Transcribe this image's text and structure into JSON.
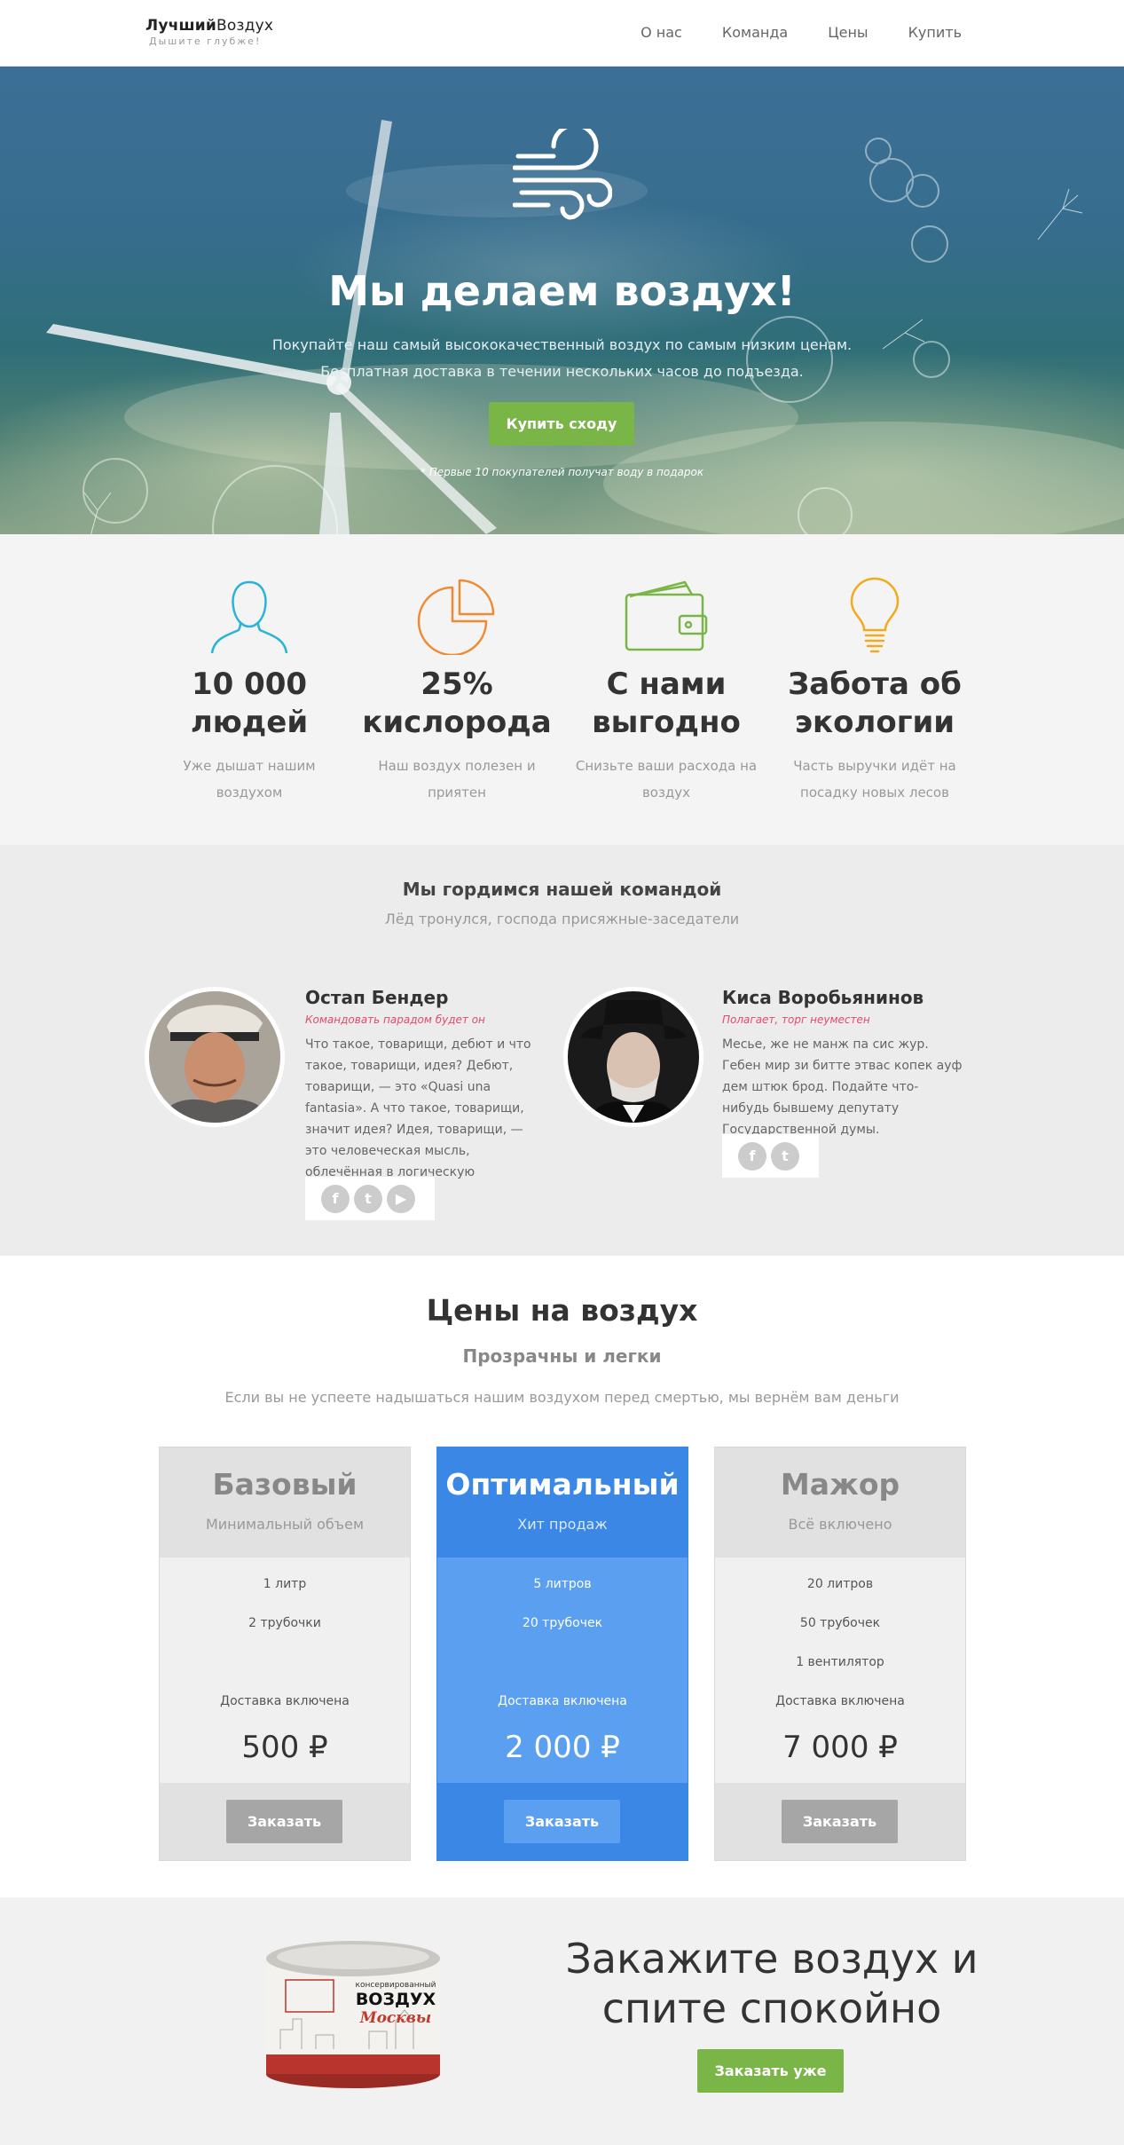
{
  "header": {
    "logo_bold": "Лучший",
    "logo_light": "Воздух",
    "tagline": "Дышите глубже!",
    "nav": [
      "О нас",
      "Команда",
      "Цены",
      "Купить"
    ]
  },
  "hero": {
    "title": "Мы делаем воздух!",
    "line1": "Покупайте наш самый высококачественный воздух по самым низким ценам.",
    "line2": "Бесплатная доставка в течении нескольких часов до подъезда.",
    "button": "Купить сходу",
    "note": "* Первые 10 покупателей получат воду в подарок"
  },
  "features": [
    {
      "icon": "person-outline-icon",
      "title": "10 000 людей",
      "text": "Уже дышат нашим воздухом",
      "color": "#2bb3d6"
    },
    {
      "icon": "pie-chart-icon",
      "title": "25% кислорода",
      "text": "Наш воздух полезен и приятен",
      "color": "#f08a32"
    },
    {
      "icon": "wallet-icon",
      "title": "С нами выгодно",
      "text": "Снизьте ваши расхода на воздух",
      "color": "#7ab547"
    },
    {
      "icon": "lightbulb-icon",
      "title": "Забота об экологии",
      "text": "Часть выручки идёт на посадку новых лесов",
      "color": "#f2a91e"
    }
  ],
  "team": {
    "title": "Мы гордимся нашей командой",
    "subtitle": "Лёд тронулся, господа присяжные-заседатели",
    "members": [
      {
        "name": "Остап Бендер",
        "role": "Командовать парадом будет он",
        "bio": "Что такое, товарищи, дебют и что такое, товарищи, идея? Дебют, товарищи, — это «Quasi una fantasia». А что такое, товарищи, значит идея? Идея, товарищи, — это человеческая мысль, облечённая в логическую шахматную форму.",
        "socials": [
          "facebook-icon",
          "twitter-icon",
          "youtube-icon"
        ]
      },
      {
        "name": "Киса Воробьянинов",
        "role": "Полагает, торг неуместен",
        "bio": "Месье, же не манж па сис жур. Гебен мир зи битте этвас копек ауф дем штюк брод. Подайте что-нибудь бывшему депутату Государственной думы.",
        "socials": [
          "facebook-icon",
          "twitter-icon"
        ]
      }
    ]
  },
  "pricing": {
    "title": "Цены на воздух",
    "subtitle": "Прозрачны и легки",
    "description": "Если вы не успеете надышаться нашим воздухом перед смертью, мы вернём вам деньги",
    "plans": [
      {
        "name": "Базовый",
        "tag": "Минимальный объем",
        "items": [
          "1 литр",
          "2 трубочки"
        ],
        "delivery": "Доставка включена",
        "price": "500 ₽",
        "button": "Заказать"
      },
      {
        "name": "Оптимальный",
        "tag": "Хит продаж",
        "items": [
          "5 литров",
          "20 трубочек"
        ],
        "delivery": "Доставка включена",
        "price": "2 000 ₽",
        "button": "Заказать"
      },
      {
        "name": "Мажор",
        "tag": "Всё включено",
        "items": [
          "20 литров",
          "50 трубочек",
          "1 вентилятор"
        ],
        "delivery": "Доставка включена",
        "price": "7 000 ₽",
        "button": "Заказать"
      }
    ]
  },
  "cta": {
    "title_line1": "Закажите воздух и",
    "title_line2": "спите спокойно",
    "button": "Заказать уже",
    "can_label_top": "консервированный",
    "can_label_main": "ВОЗДУХ",
    "can_label_city": "Москвы"
  },
  "colors": {
    "accent_green": "#7ab547",
    "accent_blue": "#3b87e6",
    "role_pink": "#e24b6a"
  }
}
